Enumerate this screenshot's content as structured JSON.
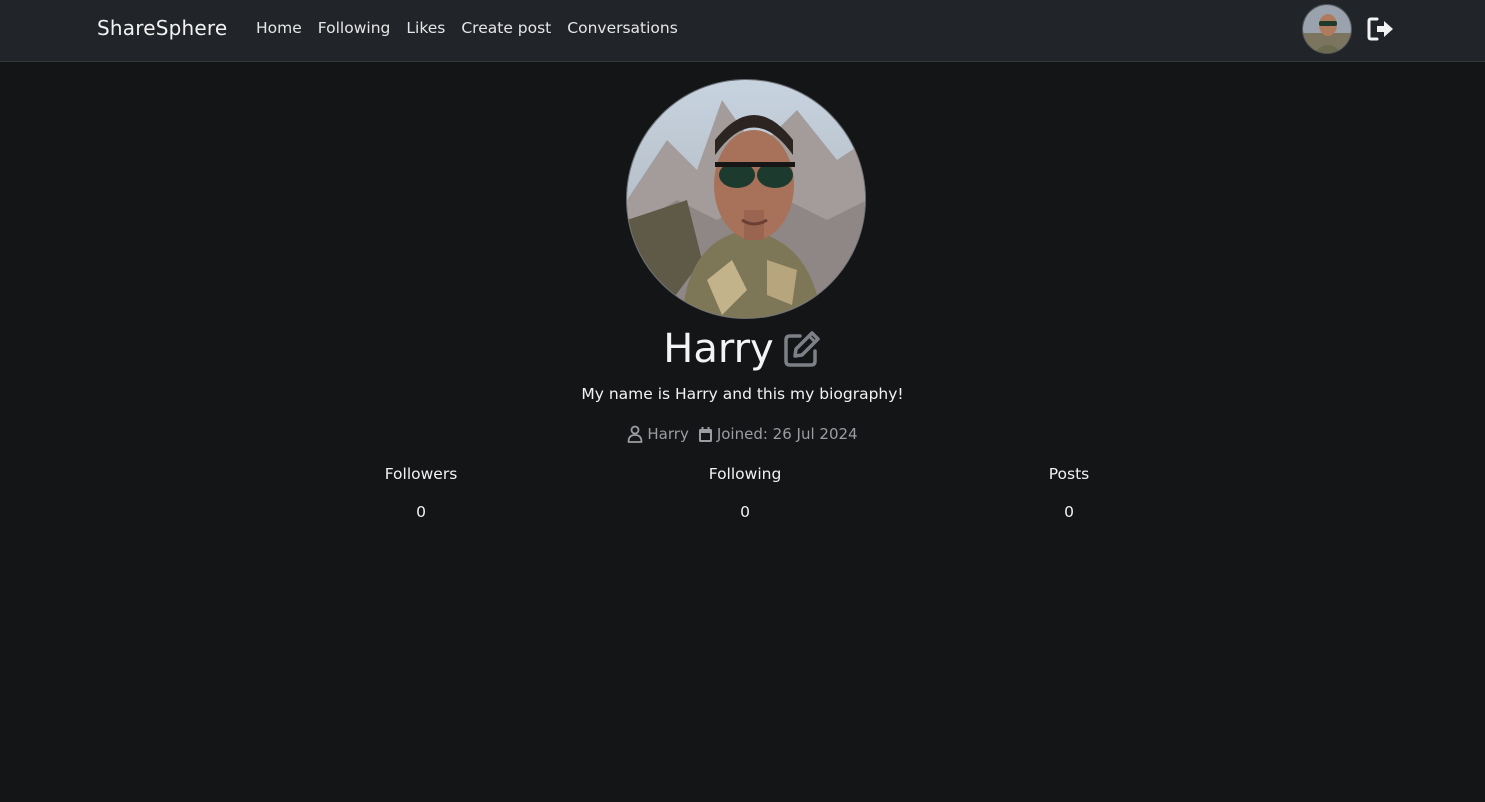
{
  "navbar": {
    "brand": "ShareSphere",
    "links": [
      "Home",
      "Following",
      "Likes",
      "Create post",
      "Conversations"
    ],
    "avatar_icon": "user-avatar",
    "logout_icon": "sign-out-icon"
  },
  "profile": {
    "name": "Harry",
    "edit_icon": "pen-to-square-icon",
    "bio": "My name is Harry and this my biography!",
    "username": "Harry",
    "joined": "Joined: 26 Jul 2024"
  },
  "stats": [
    {
      "label": "Followers",
      "value": "0"
    },
    {
      "label": "Following",
      "value": "0"
    },
    {
      "label": "Posts",
      "value": "0"
    }
  ],
  "colors": {
    "background": "#141517",
    "navbar": "#212429",
    "muted_text": "#9a9da2"
  }
}
